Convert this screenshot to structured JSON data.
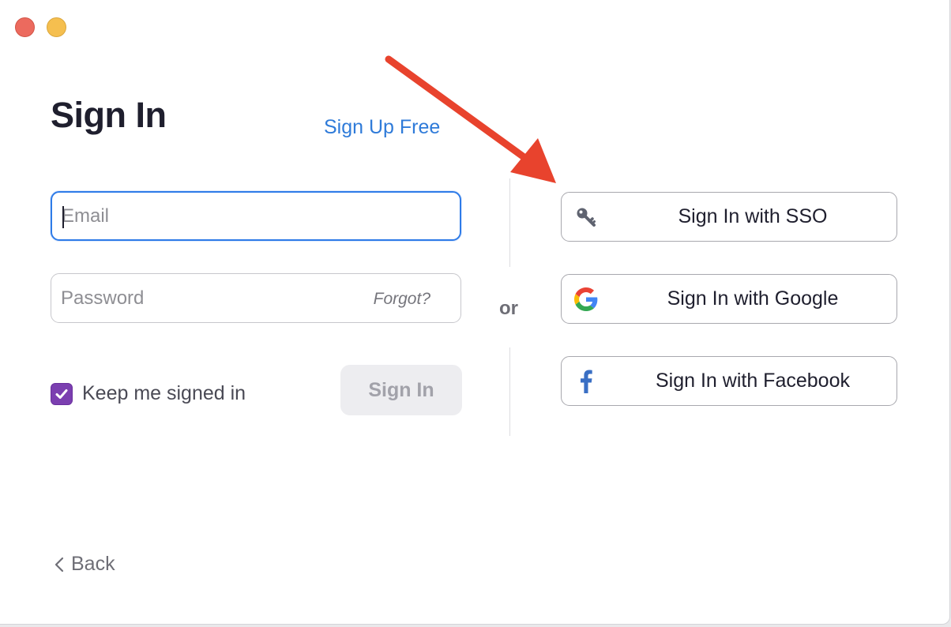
{
  "window": {
    "controls": [
      "close",
      "minimize"
    ]
  },
  "header": {
    "title": "Sign In",
    "signup_link": "Sign Up Free"
  },
  "form": {
    "email_placeholder": "Email",
    "email_value": "",
    "password_placeholder": "Password",
    "password_value": "",
    "forgot_label": "Forgot?",
    "keep_signed_in_label": "Keep me signed in",
    "keep_signed_in_checked": true,
    "signin_button_label": "Sign In"
  },
  "separator": {
    "label": "or"
  },
  "alt_signin": [
    {
      "label": "Sign In with SSO",
      "icon": "key-icon"
    },
    {
      "label": "Sign In with Google",
      "icon": "google-icon"
    },
    {
      "label": "Sign In with Facebook",
      "icon": "facebook-icon"
    }
  ],
  "footer": {
    "back_label": "Back"
  },
  "annotation": {
    "type": "arrow",
    "color": "#e8432d",
    "points_to": "Sign In with SSO"
  },
  "colors": {
    "accent": "#2e7be8",
    "link": "#2f7bd9",
    "checkbox": "#7b3fb0"
  }
}
